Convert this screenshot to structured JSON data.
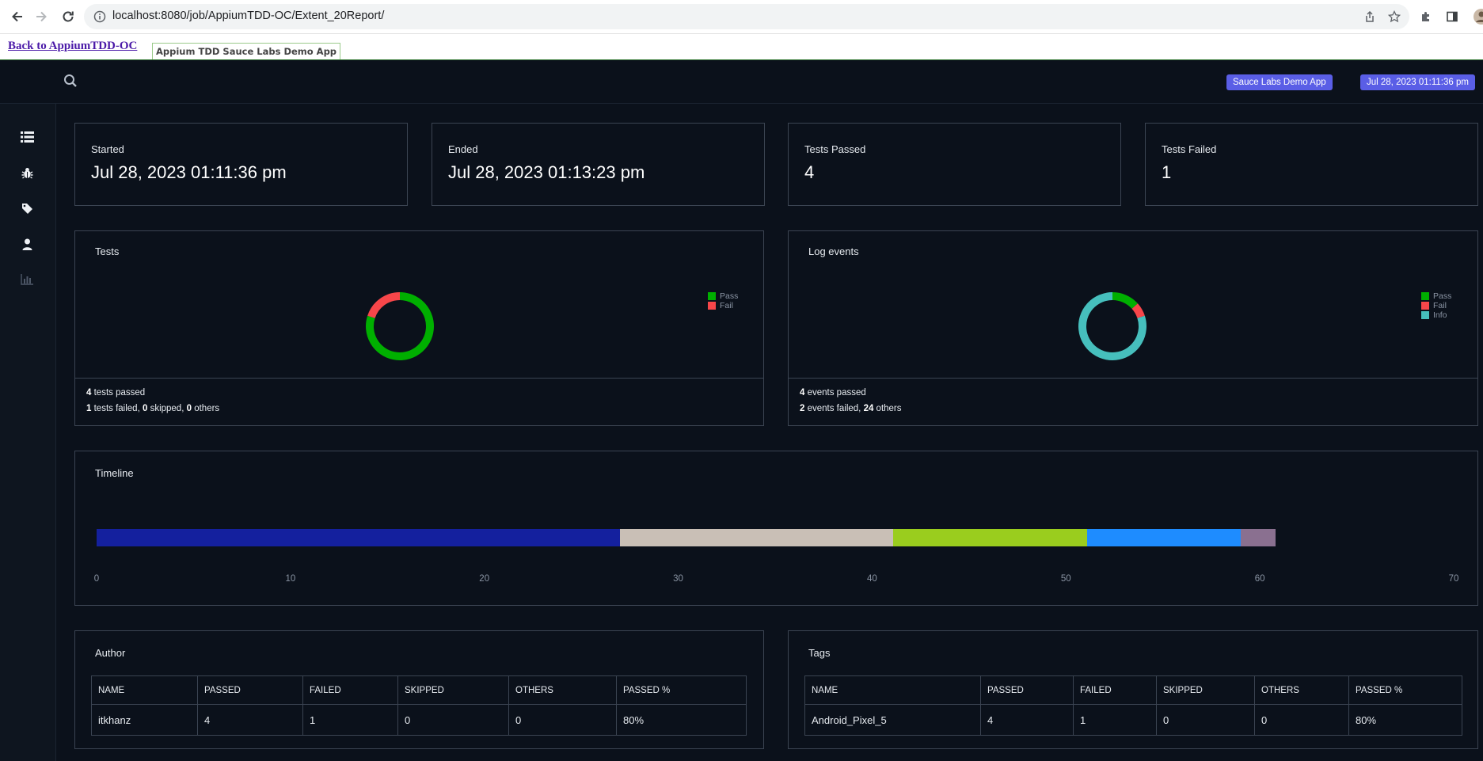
{
  "browser": {
    "url": "localhost:8080/job/AppiumTDD-OC/Extent_20Report/"
  },
  "jenkins": {
    "back_link": "Back to AppiumTDD-OC",
    "tab": "Appium TDD Sauce Labs Demo App"
  },
  "header": {
    "app_badge": "Sauce Labs Demo App",
    "date_badge": "Jul 28, 2023 01:11:36 pm"
  },
  "sidebar": {
    "icons": [
      "list-icon",
      "bug-icon",
      "tag-icon",
      "user-icon",
      "bar-chart-icon"
    ]
  },
  "stats": {
    "started_label": "Started",
    "started_value": "Jul 28, 2023 01:11:36 pm",
    "ended_label": "Ended",
    "ended_value": "Jul 28, 2023 01:13:23 pm",
    "passed_label": "Tests Passed",
    "passed_value": "4",
    "failed_label": "Tests Failed",
    "failed_value": "1"
  },
  "tests_card": {
    "title": "Tests",
    "legend": [
      "Pass",
      "Fail"
    ],
    "footer": {
      "passed_count": "4",
      "passed_text": " tests passed",
      "failed_count": "1",
      "failed_text": " tests failed, ",
      "skipped_count": "0",
      "skipped_text": " skipped, ",
      "others_count": "0",
      "others_text": " others"
    }
  },
  "log_card": {
    "title": "Log events",
    "legend": [
      "Pass",
      "Fail",
      "Info"
    ],
    "footer": {
      "passed_count": "4",
      "passed_text": " events passed",
      "failed_count": "2",
      "failed_text": " events failed, ",
      "others_count": "24",
      "others_text": " others"
    }
  },
  "timeline": {
    "title": "Timeline"
  },
  "author": {
    "title": "Author",
    "columns": [
      "NAME",
      "PASSED",
      "FAILED",
      "SKIPPED",
      "OTHERS",
      "PASSED %"
    ],
    "row": [
      "itkhanz",
      "4",
      "1",
      "0",
      "0",
      "80%"
    ]
  },
  "tags": {
    "title": "Tags",
    "columns": [
      "NAME",
      "PASSED",
      "FAILED",
      "SKIPPED",
      "OTHERS",
      "PASSED %"
    ],
    "row": [
      "Android_Pixel_5",
      "4",
      "1",
      "0",
      "0",
      "80%"
    ]
  },
  "colors": {
    "pass": "#00af00",
    "fail": "#f7464a",
    "info": "#46bfbd",
    "badge": "#5a5ee6"
  },
  "chart_data": [
    {
      "type": "pie",
      "title": "Tests",
      "labels": [
        "Pass",
        "Fail"
      ],
      "values": [
        4,
        1
      ],
      "colors": [
        "#00af00",
        "#f7464a"
      ],
      "legend": "right"
    },
    {
      "type": "pie",
      "title": "Log events",
      "labels": [
        "Pass",
        "Fail",
        "Info"
      ],
      "values": [
        4,
        2,
        24
      ],
      "colors": [
        "#00af00",
        "#f7464a",
        "#46bfbd"
      ],
      "legend": "right"
    },
    {
      "type": "bar",
      "title": "Timeline",
      "orientation": "horizontal-stacked",
      "segments": [
        {
          "start": 0,
          "end": 27,
          "color": "#14209e"
        },
        {
          "start": 27,
          "end": 41.1,
          "color": "#c9bfb6"
        },
        {
          "start": 41.1,
          "end": 51.1,
          "color": "#9acd1e"
        },
        {
          "start": 51.1,
          "end": 59,
          "color": "#1e8cff"
        },
        {
          "start": 59,
          "end": 60.8,
          "color": "#8a7090"
        }
      ],
      "x_ticks": [
        "0",
        "10",
        "20",
        "30",
        "40",
        "50",
        "60",
        "70"
      ],
      "xlim": [
        0,
        70
      ]
    }
  ]
}
